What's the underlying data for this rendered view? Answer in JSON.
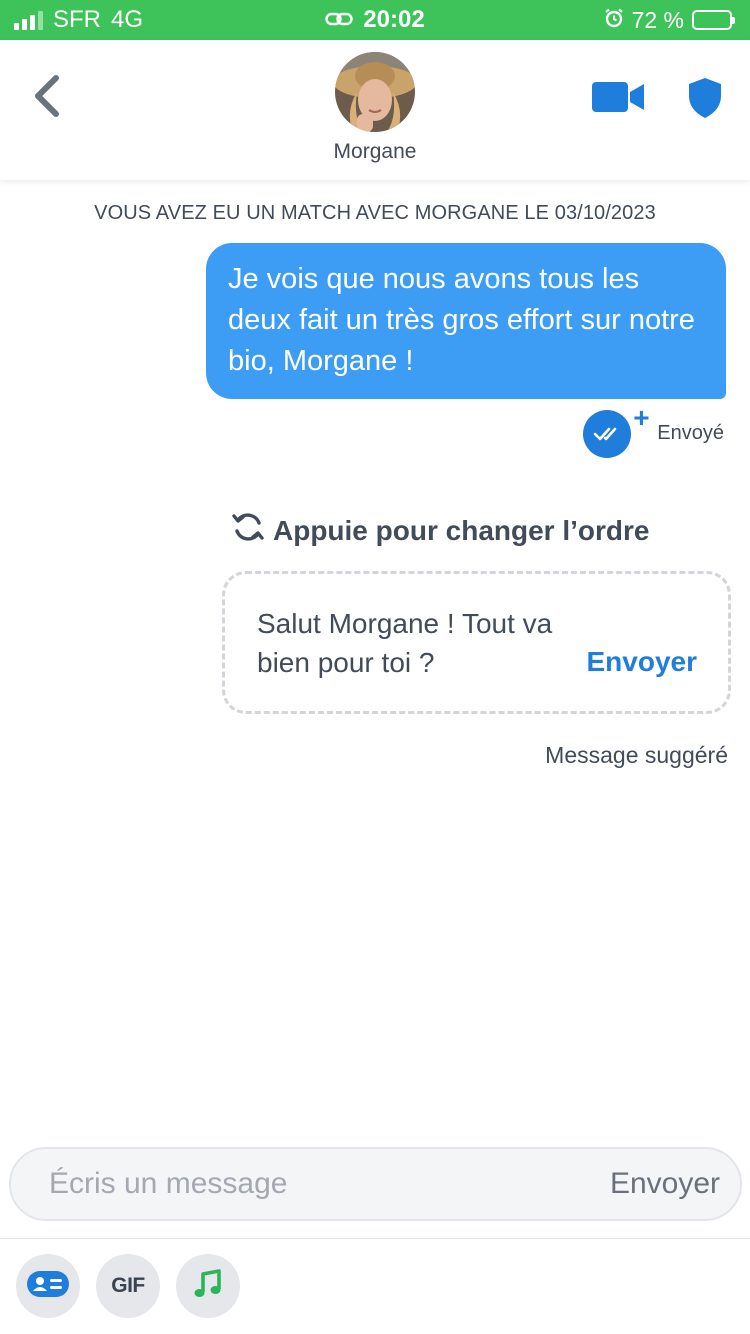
{
  "status_bar": {
    "carrier": "SFR",
    "network": "4G",
    "time": "20:02",
    "battery_percent": "72 %",
    "battery_level": 0.72,
    "background_color": "#3ec35a"
  },
  "header": {
    "contact_name": "Morgane",
    "icons": {
      "back": "chevron-left-icon",
      "video": "video-camera-icon",
      "safety": "shield-icon"
    },
    "accent_color": "#1f7ddc"
  },
  "chat": {
    "match_banner": "VOUS AVEZ EU UN MATCH AVEC MORGANE LE 03/10/2023",
    "messages": [
      {
        "direction": "outgoing",
        "text": "Je vois que nous avons tous les deux fait un très gros effort sur notre bio, Morgane !",
        "status": "Envoyé"
      }
    ],
    "bubble_color": "#3d9df4"
  },
  "suggestion": {
    "reorder_label": "Appuie pour changer l’ordre",
    "text": "Salut Morgane ! Tout va bien pour toi ?",
    "send_label": "Envoyer",
    "caption": "Message suggéré"
  },
  "composer": {
    "placeholder": "Écris un message",
    "value": "",
    "send_label": "Envoyer"
  },
  "toolbar": {
    "items": [
      {
        "name": "sticker-card-icon"
      },
      {
        "name": "gif-icon",
        "label": "GIF"
      },
      {
        "name": "music-note-icon"
      }
    ]
  }
}
